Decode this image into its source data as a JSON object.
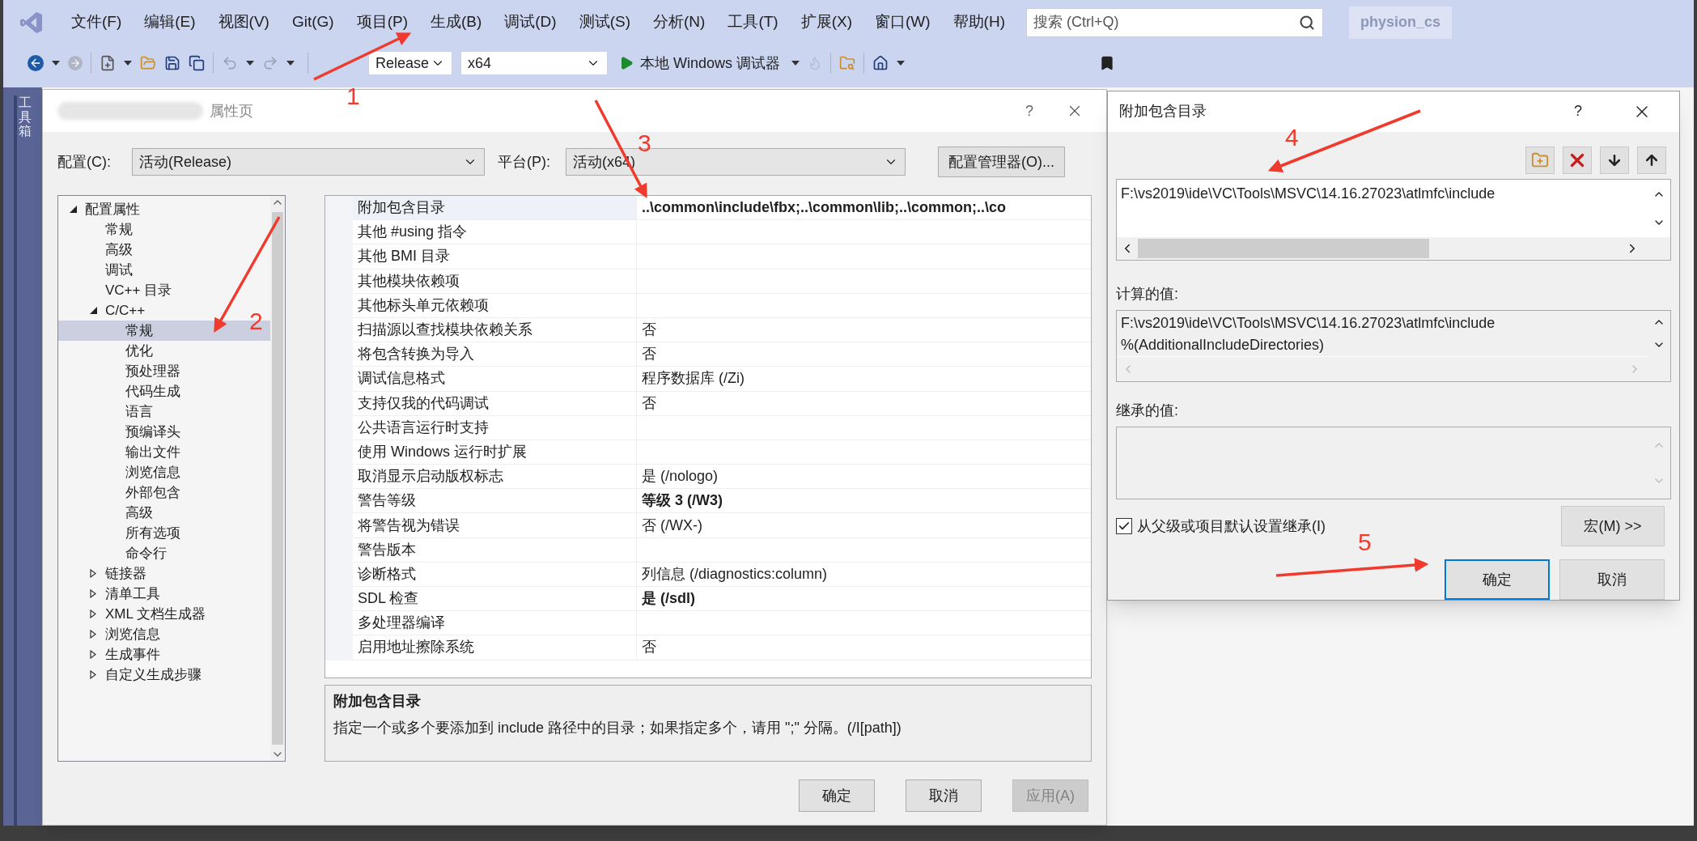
{
  "menu": [
    "文件(F)",
    "编辑(E)",
    "视图(V)",
    "Git(G)",
    "项目(P)",
    "生成(B)",
    "调试(D)",
    "测试(S)",
    "分析(N)",
    "工具(T)",
    "扩展(X)",
    "窗口(W)",
    "帮助(H)"
  ],
  "search": {
    "placeholder": "搜索 (Ctrl+Q)"
  },
  "solution_name": "physion_cs",
  "toolbar": {
    "configuration": "Release",
    "platform": "x64",
    "debugger": "本地 Windows 调试器"
  },
  "side_tab": "工具箱",
  "property_dialog": {
    "title": "属性页",
    "help": "?",
    "config_label": "配置(C):",
    "config_value": "活动(Release)",
    "platform_label": "平台(P):",
    "platform_value": "活动(x64)",
    "manager_button": "配置管理器(O)...",
    "tree": [
      {
        "label": "配置属性",
        "expanded": true,
        "selected": false,
        "children": [
          {
            "label": "常规",
            "selected": false
          },
          {
            "label": "高级",
            "selected": false
          },
          {
            "label": "调试",
            "selected": false
          },
          {
            "label": "VC++ 目录",
            "selected": false
          },
          {
            "label": "C/C++",
            "expanded": true,
            "selected": false,
            "children": [
              {
                "label": "常规",
                "selected": true
              },
              {
                "label": "优化",
                "selected": false
              },
              {
                "label": "预处理器",
                "selected": false
              },
              {
                "label": "代码生成",
                "selected": false
              },
              {
                "label": "语言",
                "selected": false
              },
              {
                "label": "预编译头",
                "selected": false
              },
              {
                "label": "输出文件",
                "selected": false
              },
              {
                "label": "浏览信息",
                "selected": false
              },
              {
                "label": "外部包含",
                "selected": false
              },
              {
                "label": "高级",
                "selected": false
              },
              {
                "label": "所有选项",
                "selected": false
              },
              {
                "label": "命令行",
                "selected": false
              }
            ]
          },
          {
            "label": "链接器",
            "expanded": false,
            "selected": false
          },
          {
            "label": "清单工具",
            "expanded": false,
            "selected": false
          },
          {
            "label": "XML 文档生成器",
            "expanded": false,
            "selected": false
          },
          {
            "label": "浏览信息",
            "expanded": false,
            "selected": false
          },
          {
            "label": "生成事件",
            "expanded": false,
            "selected": false
          },
          {
            "label": "自定义生成步骤",
            "expanded": false,
            "selected": false
          }
        ]
      }
    ],
    "rows": [
      {
        "name": "附加包含目录",
        "value": "..\\common\\include\\fbx;..\\common\\lib;..\\common;..\\co",
        "selected": true,
        "modified": true
      },
      {
        "name": "其他 #using 指令",
        "selected": false
      },
      {
        "name": "其他 BMI 目录",
        "selected": false
      },
      {
        "name": "其他模块依赖项",
        "selected": false
      },
      {
        "name": "其他标头单元依赖项",
        "selected": false
      },
      {
        "name": "扫描源以查找模块依赖关系",
        "value": "否",
        "selected": false,
        "modified": false
      },
      {
        "name": "将包含转换为导入",
        "value": "否",
        "selected": false,
        "modified": false
      },
      {
        "name": "调试信息格式",
        "value": "程序数据库 (/Zi)",
        "selected": false,
        "modified": false
      },
      {
        "name": "支持仅我的代码调试",
        "value": "否",
        "selected": false,
        "modified": false
      },
      {
        "name": "公共语言运行时支持",
        "selected": false
      },
      {
        "name": "使用 Windows 运行时扩展",
        "selected": false
      },
      {
        "name": "取消显示启动版权标志",
        "value": "是 (/nologo)",
        "selected": false,
        "modified": false
      },
      {
        "name": "警告等级",
        "value": "等级 3 (/W3)",
        "selected": false,
        "modified": true
      },
      {
        "name": "将警告视为错误",
        "value": "否 (/WX-)",
        "selected": false,
        "modified": false
      },
      {
        "name": "警告版本",
        "selected": false
      },
      {
        "name": "诊断格式",
        "value": "列信息 (/diagnostics:column)",
        "selected": false,
        "modified": false
      },
      {
        "name": "SDL 检查",
        "value": "是 (/sdl)",
        "selected": false,
        "modified": true
      },
      {
        "name": "多处理器编译",
        "selected": false
      },
      {
        "name": "启用地址擦除系统",
        "value": "否",
        "selected": false,
        "modified": false
      }
    ],
    "description": {
      "title": "附加包含目录",
      "text": "指定一个或多个要添加到 include 路径中的目录；如果指定多个，请用 \";\" 分隔。(/I[path])"
    },
    "buttons": [
      {
        "label": "确定",
        "disabled": false
      },
      {
        "label": "取消",
        "disabled": false
      },
      {
        "label": "应用(A)",
        "disabled": true
      }
    ]
  },
  "include_dialog": {
    "title": "附加包含目录",
    "help": "?",
    "entries": [
      "F:\\vs2019\\ide\\VC\\Tools\\MSVC\\14.16.27023\\atlmfc\\include"
    ],
    "computed_label": "计算的值:",
    "computed_lines": [
      "F:\\vs2019\\ide\\VC\\Tools\\MSVC\\14.16.27023\\atlmfc\\include",
      "%(AdditionalIncludeDirectories)"
    ],
    "inherited_label": "继承的值:",
    "inherit": {
      "label": "从父级或项目默认设置继承(I)",
      "checked": true
    },
    "macro_button": "宏(M) >>",
    "buttons": [
      {
        "label": "确定",
        "default": true
      },
      {
        "label": "取消",
        "default": false
      }
    ]
  },
  "annotations": [
    {
      "label": "1"
    },
    {
      "label": "2"
    },
    {
      "label": "3"
    },
    {
      "label": "4"
    },
    {
      "label": "5"
    }
  ]
}
